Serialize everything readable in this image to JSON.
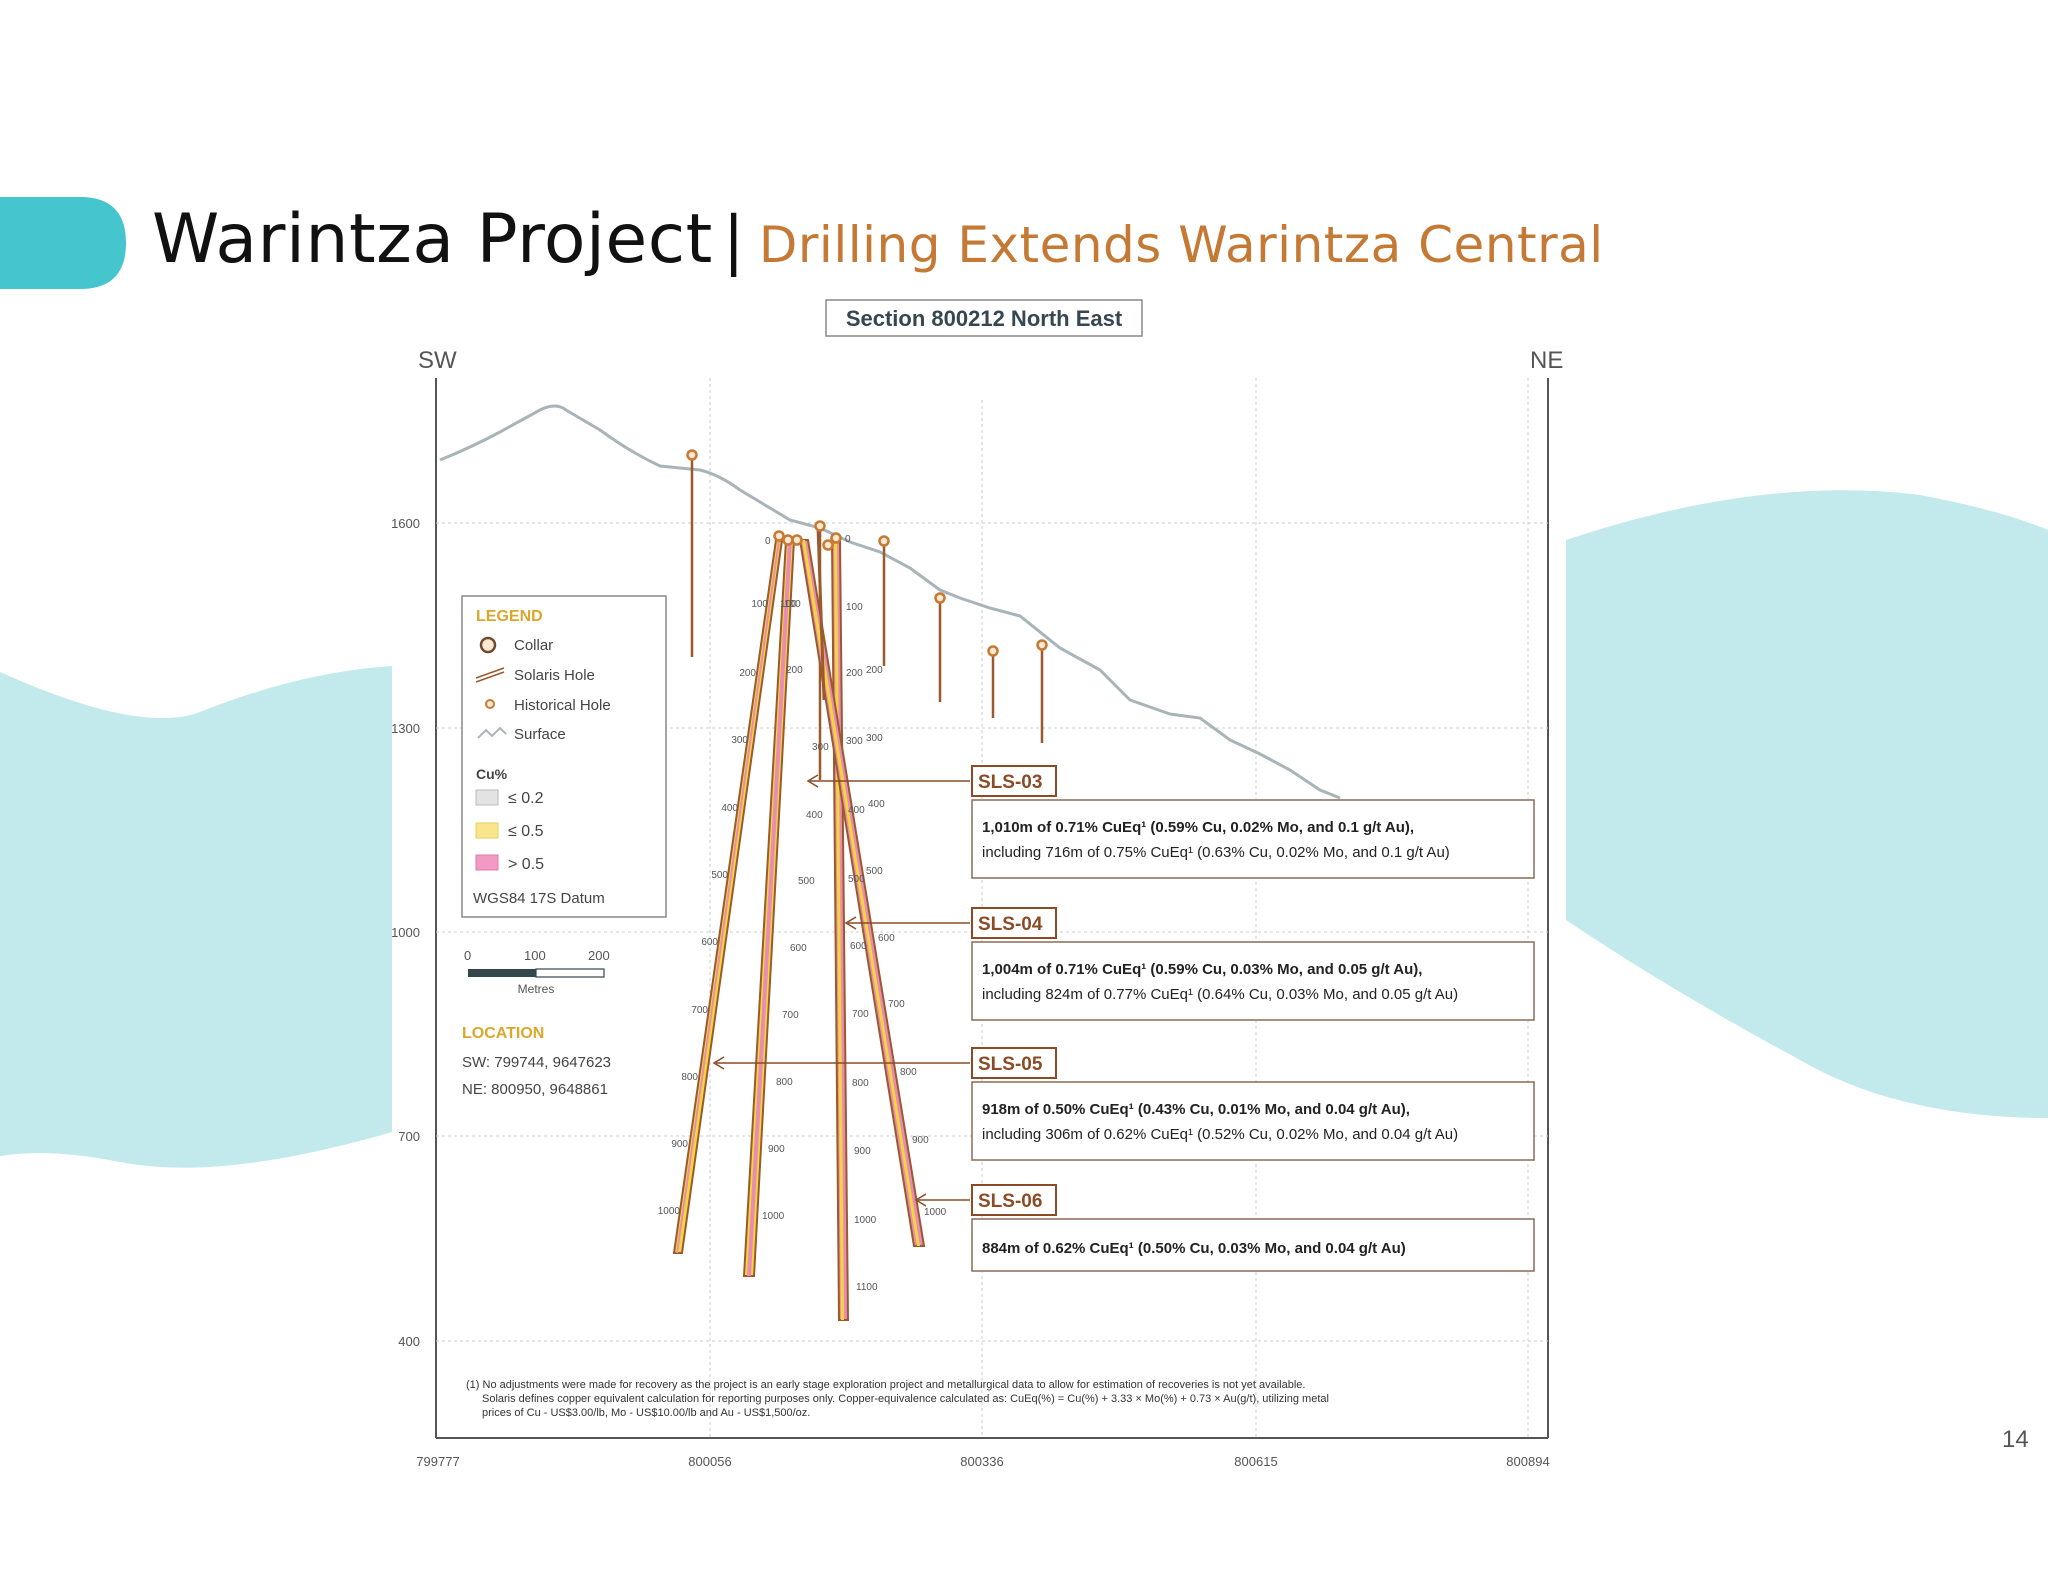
{
  "title": {
    "main": "Warintza Project",
    "separator": "|",
    "subtitle": "Drilling Extends Warintza Central"
  },
  "page_number": "14",
  "colors": {
    "accent_teal": "#45c6cf",
    "light_teal": "#c2e9ec",
    "subtitle_orange": "#c47a35",
    "hole_brown": "#9a5a2e",
    "legend_gold": "#d9a72c",
    "surface_grey": "#a9b4b9"
  },
  "section": {
    "title": "Section 800212 North East",
    "left_label": "SW",
    "right_label": "NE",
    "y_ticks": [
      "1600",
      "1300",
      "1000",
      "700",
      "400"
    ],
    "x_ticks": [
      "799777",
      "800056",
      "800336",
      "800615",
      "800894"
    ]
  },
  "legend": {
    "title": "LEGEND",
    "items": {
      "collar": "Collar",
      "solaris_hole": "Solaris Hole",
      "historical_hole": "Historical Hole",
      "surface": "Surface"
    },
    "cu_title": "Cu%",
    "cu_items": {
      "low": "≤ 0.2",
      "mid": "≤ 0.5",
      "high": "> 0.5"
    },
    "datum": "WGS84 17S Datum"
  },
  "scale_bar": {
    "labels": [
      "0",
      "100",
      "200"
    ],
    "unit": "Metres"
  },
  "location": {
    "title": "LOCATION",
    "sw": "SW: 799744, 9647623",
    "ne": "NE:  800950, 9648861"
  },
  "holes": [
    {
      "id": "SLS-03",
      "line1": "1,010m of 0.71% CuEq¹ (0.59% Cu, 0.02% Mo, and 0.1 g/t Au),",
      "line2": "including 716m of 0.75% CuEq¹ (0.63% Cu, 0.02% Mo, and 0.1 g/t Au)"
    },
    {
      "id": "SLS-04",
      "line1": "1,004m of 0.71% CuEq¹ (0.59% Cu, 0.03% Mo, and 0.05 g/t Au),",
      "line2": "including 824m of 0.77% CuEq¹ (0.64% Cu, 0.03% Mo, and 0.05 g/t Au)"
    },
    {
      "id": "SLS-05",
      "line1": "918m of 0.50% CuEq¹ (0.43% Cu, 0.01% Mo, and 0.04 g/t Au),",
      "line2": "including 306m of 0.62% CuEq¹ (0.52% Cu, 0.02% Mo, and 0.04 g/t Au)"
    },
    {
      "id": "SLS-06",
      "line1": "884m of 0.62% CuEq¹ (0.50% Cu, 0.03% Mo, and 0.04 g/t Au)",
      "line2": ""
    }
  ],
  "depth_labels": {
    "hole_a": [
      "100",
      "200",
      "300",
      "400",
      "500",
      "600",
      "700",
      "800",
      "900",
      "1000"
    ],
    "hole_b": [
      "100",
      "200",
      "300",
      "400",
      "500",
      "600",
      "700",
      "800",
      "900",
      "1000"
    ],
    "hole_c": [
      "100",
      "200",
      "300",
      "400",
      "500",
      "600",
      "700",
      "800",
      "900",
      "1000",
      "1100"
    ],
    "hole_d": [
      "100",
      "200",
      "300",
      "400",
      "500",
      "600",
      "700",
      "800",
      "900",
      "1000"
    ]
  },
  "footnote": {
    "line1": "(1) No adjustments were made for recovery as the project is an early stage exploration project and metallurgical data to allow for estimation of recoveries is not yet available.",
    "line2": "Solaris defines copper equivalent calculation for reporting purposes only. Copper-equivalence calculated as:  CuEq(%) = Cu(%) + 3.33 × Mo(%) + 0.73 × Au(g/t), utilizing metal",
    "line3": "prices of Cu - US$3.00/lb, Mo - US$10.00/lb and Au - US$1,500/oz."
  }
}
